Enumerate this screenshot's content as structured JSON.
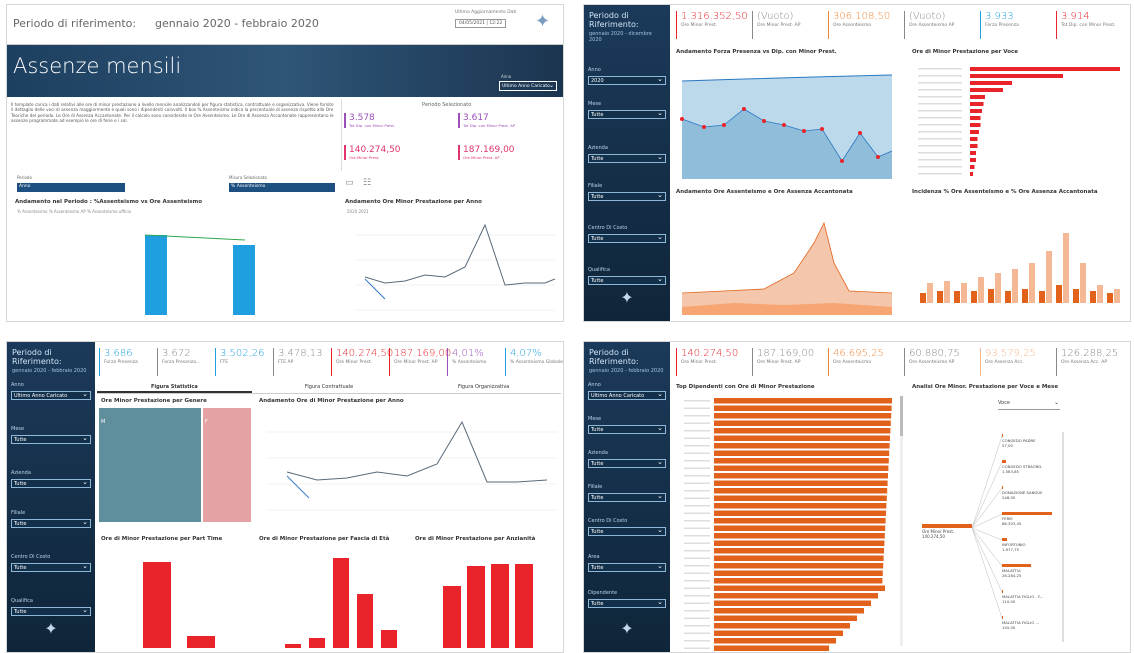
{
  "p1": {
    "period_label": "Periodo di riferimento:",
    "period_value": "gennaio 2020 - febbraio 2020",
    "update_label": "Ultimo Aggiornamento Dati",
    "update_value": "04/05/2021 | 12:22",
    "title": "Assenze mensili",
    "anno_label": "Anno",
    "anno_value": "Ultimo Anno Caricato",
    "desc": "Il template carica i dati relativi alle ore di minor prestazione a livello mensile analizzandoli per figura statistica, contrattuale e organizzativa. Viene fornito il dettaglio delle voci di assenza maggiormente e quali sono i dipendenti coinvolti. Il box % Assenteismo indica la percentuale di assenza rispetto alle Ore Teoriche del periodo. Le Ore di Assenza Accantonate. Per il calcolo sono considerate le Ore Assenteismo. Le Ore di Assenza Accantonate rappresentano le assenze programmate ad esempio le ore di ferie e i sol.",
    "sel_title": "Periodo Selezionato",
    "k1v": "3.578",
    "k1l": "Tot Dip. con Minor Prest.",
    "k2v": "3.617",
    "k2l": "Tot Dip. con Minor Prest. AP",
    "k3v": "140.274,50",
    "k3l": "Ore Minor Prest.",
    "k4v": "187.169,00",
    "k4l": "Ore Minor Prest. AP",
    "f1_label": "Periodo",
    "f1_value": "Anno",
    "f2_label": "Misura Selezionata",
    "f2_value": "% Assenteismo",
    "c1_title": "Andamento nel Periodo : %Assenteismo vs Ore Assenteismo",
    "c1_legend": "% Assenteismo  % Assenteismo AP  % Assenteismo ufficio",
    "c2_title": "Andamento Ore Minor Prestazione per Anno",
    "c2_legend": "2020  2021"
  },
  "p2": {
    "period_label": "Periodo di Riferimento:",
    "period_value": "gennaio 2020 - dicembre 2020",
    "filters": [
      "Anno",
      "Mese",
      "Azienda",
      "Filiale",
      "Centro Di Costo",
      "Qualifica"
    ],
    "filter_values": [
      "2020",
      "Tutte",
      "Tutte",
      "Tutte",
      "Tutte",
      "Tutte"
    ],
    "kpis": [
      {
        "v": "1.316.352,50",
        "l": "Ore Minor Prest."
      },
      {
        "v": "(Vuoto)",
        "l": "Ore Minor Prest. AP"
      },
      {
        "v": "306.108,50",
        "l": "Ore Assenteismo"
      },
      {
        "v": "(Vuoto)",
        "l": "Ore Assenteismo AP"
      },
      {
        "v": "3.933",
        "l": "Forza Presenza"
      },
      {
        "v": "3.914",
        "l": "Tot Dip. con Minor Prest."
      }
    ],
    "c1_title": "Andamento Forza Presenza vs Dip. con Minor Prest.",
    "c2_title": "Ore di Minor Prestazione per Voce",
    "c3_title": "Andamento Ore Assenteismo e Ore Assenza Accantonata",
    "c4_title": "Incidenza % Ore Assenteismo e % Ore Assenza Accantonata"
  },
  "p3": {
    "period_label": "Periodo di Riferimento:",
    "period_value": "gennaio 2020 - febbraio 2020",
    "filters": [
      "Anno",
      "Mese",
      "Azienda",
      "Filiale",
      "Centro Di Costo",
      "Qualifica"
    ],
    "filter_values": [
      "Ultimo Anno Caricato",
      "Tutte",
      "Tutte",
      "Tutte",
      "Tutte",
      "Tutte"
    ],
    "kpis": [
      {
        "v": "3.686",
        "l": "Forza Presenza"
      },
      {
        "v": "3.672",
        "l": "Forza Presenza..."
      },
      {
        "v": "3.502,26",
        "l": "FTE"
      },
      {
        "v": "3.478,13",
        "l": "FTE AP"
      },
      {
        "v": "140.274,50",
        "l": "Ore Minor Prest."
      },
      {
        "v": "187.169,00",
        "l": "Ore Minor Prest. AP"
      },
      {
        "v": "4,01%",
        "l": "% Assenteismo"
      },
      {
        "v": "4,07%",
        "l": "% Assenteismo Globale"
      }
    ],
    "tabs": [
      "Figura Statistica",
      "Figura Contrattuale",
      "Figura Organizzativa"
    ],
    "c1_title": "Ore Minor Prestazione per Genere",
    "c1_m": "M",
    "c1_f": "F",
    "c2_title": "Andamento Ore di Minor Prestazione per Anno",
    "c3_title": "Ore di Minor Prestazione per Part Time",
    "c4_title": "Ore di Minor Prestazione per Fascia di Età",
    "c5_title": "Ore di Minor Prestazione per Anzianità"
  },
  "p4": {
    "period_label": "Periodo di Riferimento:",
    "period_value": "gennaio 2020 - febbraio 2020",
    "filters": [
      "Anno",
      "Mese",
      "Azienda",
      "Filiale",
      "Centro Di Costo",
      "Area",
      "Dipendente"
    ],
    "filter_values": [
      "Ultimo Anno Caricato",
      "Tutte",
      "Tutte",
      "Tutte",
      "Tutte",
      "Tutte",
      "Tutte"
    ],
    "kpis": [
      {
        "v": "140.274,50",
        "l": "Ore Minor Prest."
      },
      {
        "v": "187.169,00",
        "l": "Ore Minor Prest. AP"
      },
      {
        "v": "46.695,25",
        "l": "Ore Assenteismo"
      },
      {
        "v": "60.880,75",
        "l": "Ore Assenteismo AP"
      },
      {
        "v": "93.579,25",
        "l": "Ore Assenza Acc."
      },
      {
        "v": "126.288,25",
        "l": "Ore Assenza Acc. AP"
      }
    ],
    "c1_title": "Top Dipendenti con Ore di Minor Prestazione",
    "c2_title": "Analisi Ore Minor. Prestazione per Voce e Mese",
    "voce": "Voce",
    "root_label": "Ore Minor Prest.",
    "root_value": "140.274,50",
    "tree": [
      {
        "n": "CONGEDO PADRE",
        "v": "57,00"
      },
      {
        "n": "CONGEDO STRAORD.",
        "v": "1.563,85"
      },
      {
        "n": "DONAZIONE SANGUE",
        "v": "248,00"
      },
      {
        "n": "FERIE",
        "v": "88.303,45"
      },
      {
        "n": "INFORTUNIO",
        "v": "1.977,75"
      },
      {
        "n": "MALATTIA",
        "v": "26.284,25"
      },
      {
        "n": "MALATTIA FIGLIO - F...",
        "v": "110,00"
      },
      {
        "n": "MALATTIA FIGLIO ...",
        "v": "145,00"
      }
    ]
  },
  "colors": {
    "navy": "#1b3a5a",
    "red": "#e8232a",
    "orange": "#e2621b",
    "blue": "#1f9fe0",
    "teal": "#5b8fa0"
  }
}
